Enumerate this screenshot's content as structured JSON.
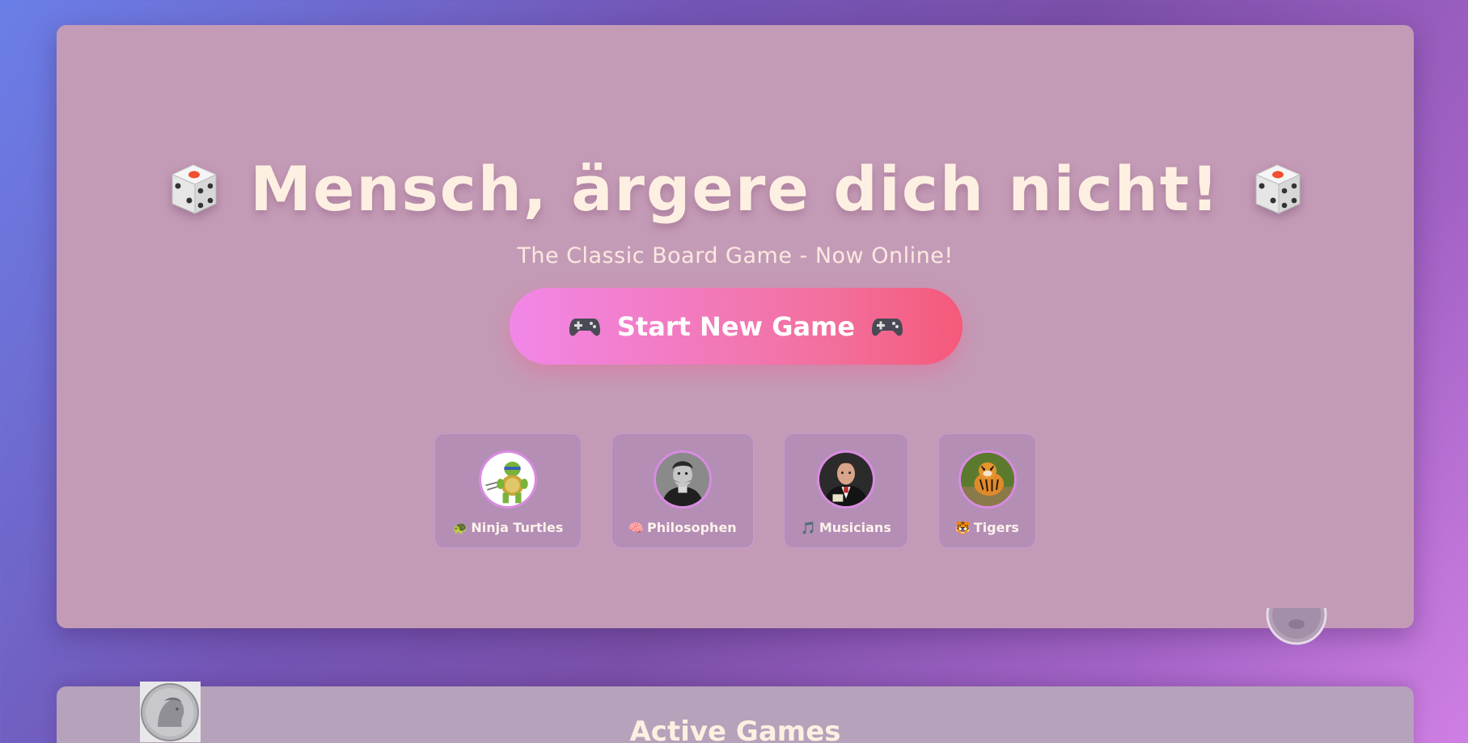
{
  "header": {
    "title": "Mensch, ärgere dich nicht!",
    "left_icon": "die-icon",
    "right_icon": "die-icon",
    "subtitle": "The Classic Board Game - Now Online!"
  },
  "start_button": {
    "label": "Start New Game",
    "icon": "gamepad-icon"
  },
  "themes": [
    {
      "emoji": "🐢",
      "label": "Ninja Turtles",
      "image": "ninja-turtle-avatar"
    },
    {
      "emoji": "🧠",
      "label": "Philosophen",
      "image": "philosopher-avatar"
    },
    {
      "emoji": "🎵",
      "label": "Musicians",
      "image": "musician-avatar"
    },
    {
      "emoji": "🐯",
      "label": "Tigers",
      "image": "tiger-avatar"
    }
  ],
  "active_games": {
    "title": "Active Games"
  },
  "colors": {
    "hero_bg": "#c49bb6",
    "title_color": "#fdf0e2",
    "button_gradient_start": "#f287e8",
    "button_gradient_end": "#f5597a"
  }
}
